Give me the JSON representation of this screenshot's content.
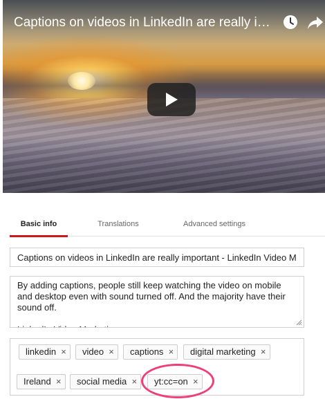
{
  "video": {
    "title": "Captions on videos in LinkedIn are really important - LinkedIn Video Marketing",
    "title_display": "Captions on videos in LinkedIn are really impo…",
    "icons": [
      "clock-icon",
      "share-icon",
      "play-icon"
    ]
  },
  "tabs": [
    {
      "label": "Basic info",
      "active": true
    },
    {
      "label": "Translations",
      "active": false
    },
    {
      "label": "Advanced settings",
      "active": false
    }
  ],
  "form": {
    "title_value": "Captions on videos in LinkedIn are really important - LinkedIn Video Ma",
    "description": "By adding captions, people still keep watching the video on mobile and desktop even with sound turned off. And the majority have their sound off.\n\nLinkedIn Video Marketing",
    "tags": [
      "linkedin",
      "video",
      "captions",
      "digital marketing",
      "Ireland",
      "social media",
      "yt:cc=on"
    ],
    "tag_remove_glyph": "×"
  },
  "colors": {
    "active_tab_underline": "#cc181e",
    "highlight_circle": "#ee3f78"
  }
}
